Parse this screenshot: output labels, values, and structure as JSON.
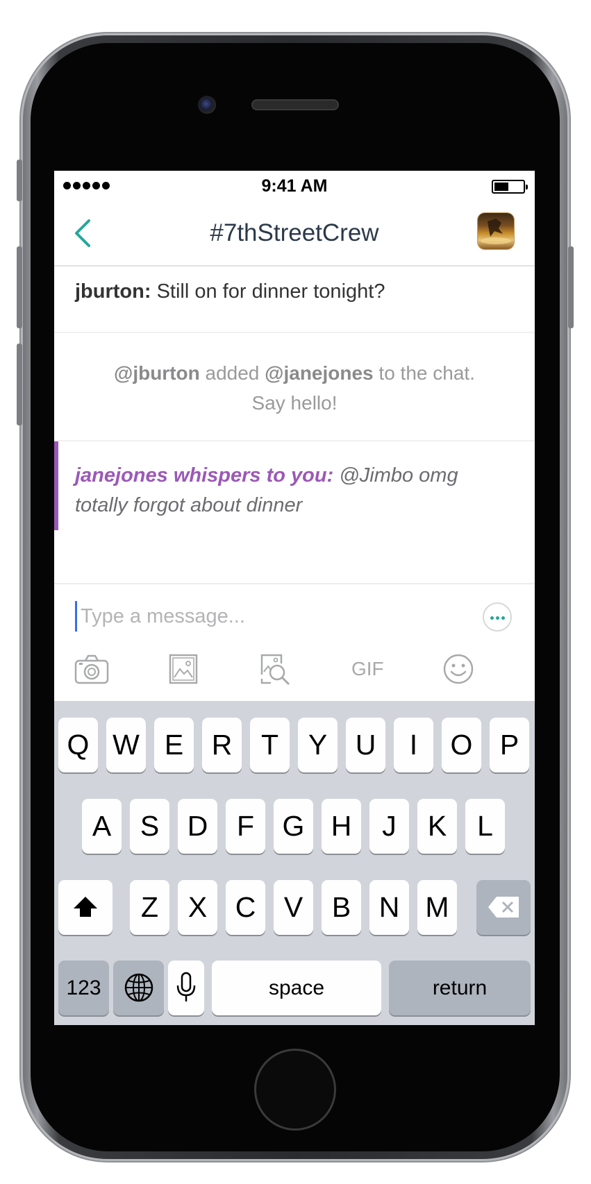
{
  "status_bar": {
    "time": "9:41 AM"
  },
  "nav": {
    "title": "#7thStreetCrew"
  },
  "messages": [
    {
      "user": "jburton:",
      "text": "Still on for dinner tonight?"
    },
    {
      "system_user1": "@jburton",
      "system_mid": "added",
      "system_user2": "@janejones",
      "system_end": "to the chat.",
      "system_line2": "Say hello!"
    },
    {
      "whisper_label": "janejones whispers to you:",
      "text": "@Jimbo omg totally forgot about dinner"
    }
  ],
  "composer": {
    "placeholder": "Type a message...",
    "gif_label": "GIF"
  },
  "keyboard": {
    "row1": [
      "Q",
      "W",
      "E",
      "R",
      "T",
      "Y",
      "U",
      "I",
      "O",
      "P"
    ],
    "row2": [
      "A",
      "S",
      "D",
      "F",
      "G",
      "H",
      "J",
      "K",
      "L"
    ],
    "row3": [
      "Z",
      "X",
      "C",
      "V",
      "B",
      "N",
      "M"
    ],
    "numbers_label": "123",
    "space_label": "space",
    "return_label": "return"
  },
  "colors": {
    "accent": "#26a69a",
    "whisper": "#9b59b6",
    "title": "#2c3a4a",
    "caret": "#3b6de6",
    "keyboard_bg": "#d1d5db"
  }
}
